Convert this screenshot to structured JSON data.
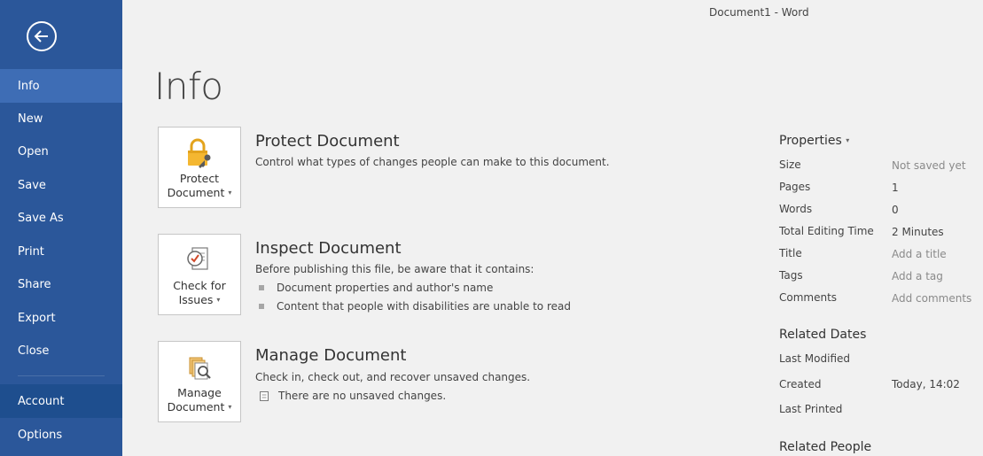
{
  "window": {
    "title": "Document1 - Word"
  },
  "sidebar": {
    "items": [
      {
        "label": "Info"
      },
      {
        "label": "New"
      },
      {
        "label": "Open"
      },
      {
        "label": "Save"
      },
      {
        "label": "Save As"
      },
      {
        "label": "Print"
      },
      {
        "label": "Share"
      },
      {
        "label": "Export"
      },
      {
        "label": "Close"
      },
      {
        "label": "Account"
      },
      {
        "label": "Options"
      }
    ],
    "active_item": "Info"
  },
  "page": {
    "title": "Info"
  },
  "sections": {
    "protect": {
      "tile_line1": "Protect",
      "tile_line2": "Document",
      "heading": "Protect Document",
      "description": "Control what types of changes people can make to this document."
    },
    "inspect": {
      "tile_line1": "Check for",
      "tile_line2": "Issues",
      "heading": "Inspect Document",
      "description": "Before publishing this file, be aware that it contains:",
      "bullets": [
        "Document properties and author's name",
        "Content that people with disabilities are unable to read"
      ]
    },
    "manage": {
      "tile_line1": "Manage",
      "tile_line2": "Document",
      "heading": "Manage Document",
      "description": "Check in, check out, and recover unsaved changes.",
      "note": "There are no unsaved changes."
    }
  },
  "properties": {
    "heading": "Properties",
    "rows": [
      {
        "label": "Size",
        "value": "Not saved yet"
      },
      {
        "label": "Pages",
        "value": "1"
      },
      {
        "label": "Words",
        "value": "0"
      },
      {
        "label": "Total Editing Time",
        "value": "2 Minutes"
      },
      {
        "label": "Title",
        "value": "Add a title"
      },
      {
        "label": "Tags",
        "value": "Add a tag"
      },
      {
        "label": "Comments",
        "value": "Add comments"
      }
    ]
  },
  "related_dates": {
    "heading": "Related Dates",
    "rows": [
      {
        "label": "Last Modified",
        "value": ""
      },
      {
        "label": "Created",
        "value": "Today, 14:02"
      },
      {
        "label": "Last Printed",
        "value": ""
      }
    ]
  },
  "related_people": {
    "heading": "Related People"
  },
  "colors": {
    "sidebar_bg": "#2b579a",
    "sidebar_active": "#3e6db5",
    "page_bg": "#f1f1f1"
  }
}
